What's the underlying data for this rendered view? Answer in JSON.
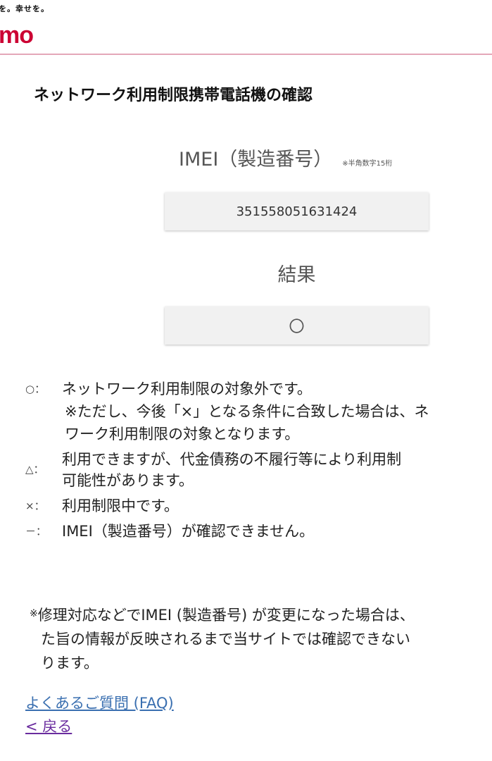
{
  "header": {
    "tagline": "を。幸せを。",
    "logo": "mo",
    "accent_color": "#cc0033"
  },
  "page": {
    "title": "ネットワーク利用制限携帯電話機の確認"
  },
  "imei": {
    "label": "IMEI（製造番号）",
    "note": "※半角数字15桁",
    "value": "351558051631424"
  },
  "result": {
    "label": "結果",
    "value": "〇"
  },
  "legend": {
    "circle": {
      "symbol": "○：",
      "text": "ネットワーク利用制限の対象外です。",
      "sub1": "※ただし、今後「×」となる条件に合致した場合は、ネ",
      "sub2": "ワーク利用制限の対象となります。"
    },
    "triangle": {
      "symbol": "△：",
      "text1": "利用できますが、代金債務の不履行等により利用制",
      "text2": "可能性があります。"
    },
    "cross": {
      "symbol": "×：",
      "text": "利用制限中です。"
    },
    "dash": {
      "symbol": "－：",
      "text": "IMEI（製造番号）が確認できません。"
    }
  },
  "footnote": {
    "mark": "※",
    "line1": "修理対応などでIMEI (製造番号) が変更になった場合は、",
    "line2": "た旨の情報が反映されるまで当サイトでは確認できない",
    "line3": "ります。"
  },
  "links": {
    "faq": "よくあるご質問 (FAQ)",
    "back": "< 戻る"
  }
}
